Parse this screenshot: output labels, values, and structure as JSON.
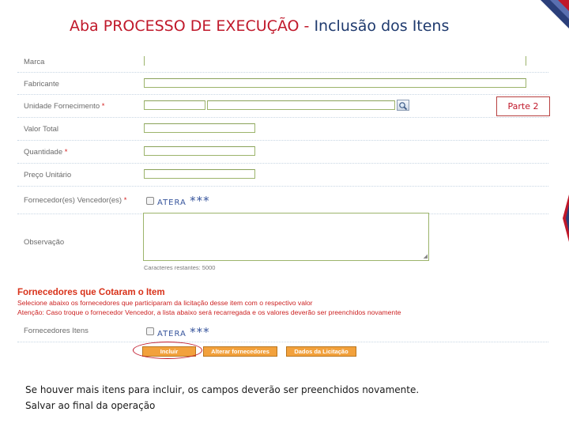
{
  "slide": {
    "title_prefix": "Aba PROCESSO DE EXECUÇÃO -",
    "title_suffix": " Inclusão dos Itens",
    "part_label": "Parte 2"
  },
  "form": {
    "fields": {
      "marca": "Marca",
      "fabricante": "Fabricante",
      "unidade_fornecimento": "Unidade Fornecimento",
      "valor_total": "Valor Total",
      "quantidade": "Quantidade",
      "preco_unitario": "Preço Unitário",
      "fornecedores_vencedor": "Fornecedor(es) Vencedor(es)",
      "observacao": "Observação"
    },
    "required_marker": "*",
    "vencedor_option": "ATERA",
    "vencedor_mask": "***",
    "chars_remaining": "Caracteres restantes: 5000"
  },
  "fornecedores": {
    "title": "Fornecedores que Cotaram o Item",
    "note1": "Selecione abaixo os fornecedores que participaram da licitação desse item com o respectivo valor",
    "note2": "Atenção: Caso troque o fornecedor Vencedor, a lista abaixo será recarregada e os valores deverão ser preenchidos novamente",
    "field_label": "Fornecedores Itens",
    "option": "ATERA",
    "mask": "***",
    "buttons": {
      "incluir": "Incluir",
      "alterar": "Alterar fornecedores",
      "dados": "Dados da Licitação"
    }
  },
  "footer": {
    "line1": "Se houver mais itens para incluir, os campos deverão ser preenchidos novamente.",
    "line2": "Salvar ao final da operação"
  },
  "colors": {
    "title_red": "#c0182a",
    "title_blue": "#1f3a6e",
    "button_orange": "#f2a13c",
    "section_red": "#d8321a"
  }
}
